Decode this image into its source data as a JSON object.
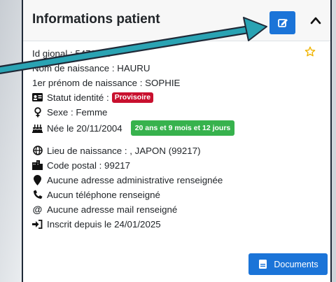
{
  "card": {
    "title": "Informations patient",
    "id_partial": "Id          gional : 5479685"
  },
  "fields": {
    "birth_name": "Nom de naissance : HAURU",
    "first_name": "1er prénom de naissance : SOPHIE",
    "identity_status_label": "Statut identité :",
    "identity_status_badge": "Provisoire",
    "sex": "Sexe : Femme",
    "birth_date": "Née le 20/11/2004",
    "age_badge": "20 ans et 9 mois et 12 jours",
    "birthplace": "Lieu de naissance : , JAPON (99217)",
    "postal_code": "Code postal : 99217",
    "address": "Aucune adresse administrative renseignée",
    "phone": "Aucun téléphone renseigné",
    "email": "Aucune adresse mail renseigné",
    "registered": "Inscrit depuis le 24/01/2025"
  },
  "buttons": {
    "documents": "Documents"
  },
  "colors": {
    "primary": "#1b74d8",
    "badge_red": "#c8102e",
    "badge_green": "#37b24d",
    "star": "#f0b400",
    "arrow": "#2aa3b3"
  }
}
